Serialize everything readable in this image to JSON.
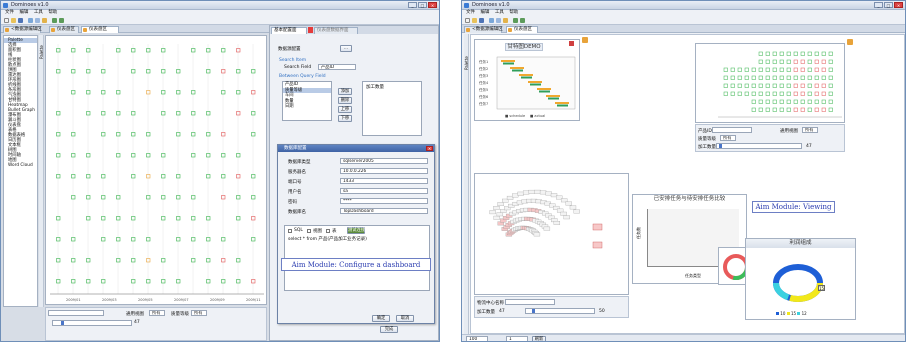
{
  "left_window": {
    "title": "Dominoes v1.0",
    "menu": [
      "文件",
      "编辑",
      "工具",
      "帮助"
    ],
    "tabs": [
      "<数据源编辑区",
      "仪表盘区",
      "仪表盘区"
    ],
    "palette_label": "Palette",
    "nav_items": [
      "Palette",
      "选择",
      "面积图",
      "线",
      "柱状图",
      "散点图",
      "饼图",
      "雷达图",
      "环形图",
      "折线图",
      "条形图",
      "气泡图",
      "甘特图",
      "Heatmap",
      "Bullet Graph",
      "瀑布图",
      "漏斗图",
      "仪表盘",
      "表格",
      "数据表格",
      "日历图",
      "文本框",
      "树图",
      "时间轴",
      "地图",
      "Word Cloud"
    ],
    "chart_axis_labels": [
      "2009/01",
      "2009/03",
      "2009/05",
      "2009/07",
      "2009/09",
      "2009/11"
    ],
    "bottom": {
      "select_label": "",
      "filter_label": "通用视图",
      "filter_value": "所有",
      "type_label": "质量等级",
      "type_value": "所有",
      "slider_value": "47"
    },
    "config_panel": {
      "title": "基本配置面",
      "tab2": "仪表盘数据界面",
      "section": "数据源配置",
      "source_button": "...",
      "search_label": "Search Item",
      "search_value": "Search Field",
      "search_select": "产品ID",
      "query_label": "Between Query Field",
      "list_left": [
        "产品ID",
        "质量等级",
        "车间",
        "数量",
        "日期"
      ],
      "list_right_header": "加工数量",
      "buttons": [
        "添加",
        "删除",
        "上移",
        "下移"
      ]
    },
    "dialog": {
      "title": "数据库配置",
      "rows": [
        {
          "label": "数据库类型",
          "value": "sqlserver2005"
        },
        {
          "label": "服务器名",
          "value": "10.0.0.226"
        },
        {
          "label": "端口号",
          "value": "1433"
        },
        {
          "label": "用户名",
          "value": "sa"
        },
        {
          "label": "密码",
          "value": "****"
        },
        {
          "label": "数据库名",
          "value": "TopDashboard"
        }
      ],
      "sql_tabs": [
        "SQL",
        "视图",
        "表"
      ],
      "test_button": "测试连接",
      "sql_text": "select * from 产品(产品加工业务记录)",
      "confirm": "确定",
      "cancel": "取消"
    },
    "final_button": "完成",
    "callout": "Aim Module: Configure a dashboard"
  },
  "right_window": {
    "title": "Dominoes v1.0",
    "menu": [
      "文件",
      "编辑",
      "工具",
      "帮助"
    ],
    "tabs": [
      "<数据源编辑区",
      "仪表盘区"
    ],
    "palette_label": "Palette",
    "gantt": {
      "title": "甘特图DEMO",
      "legend": [
        "schedule",
        "actual"
      ],
      "ylabels": [
        "任务1",
        "任务2",
        "任务3",
        "任务4",
        "任务5",
        "任务6",
        "任务7"
      ]
    },
    "heat_bottom": {
      "product_label": "产品ID",
      "product_value": "",
      "view_label": "通用视图",
      "view_value": "所有",
      "quality_label": "质量等级",
      "quality_value": "所有",
      "count_label": "加工数量",
      "count_value": "47"
    },
    "callout": "Aim Module: Viewing",
    "radial": {
      "bottom_label": "物流中心名称",
      "bottom_value": "",
      "count_label": "加工数量",
      "count_value": "47",
      "slider_value": "50"
    },
    "compare_title": "已安排任务与待安排任务比较",
    "compare_ylabel": "任务数",
    "compare_xlabel": "任务类型",
    "pie_title": "利润组成",
    "pie_legend": [
      "10",
      "15",
      "12"
    ],
    "pie_label": "15",
    "status": {
      "zoom": "100",
      "page": "1",
      "button": "刷新"
    }
  },
  "colors": {
    "accent_green": "#35b24a",
    "accent_red": "#e05454",
    "accent_orange": "#e8a33a",
    "callout_blue": "#2b3db0"
  }
}
